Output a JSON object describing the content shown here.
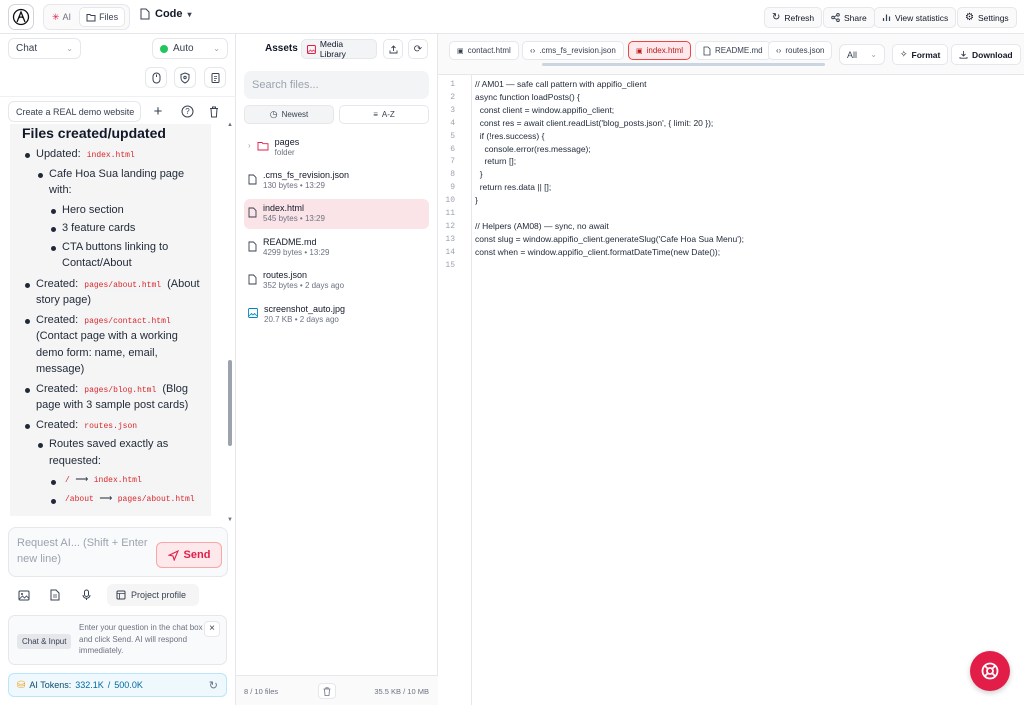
{
  "topbar": {
    "tabs": [
      {
        "label": "AI",
        "icon": "sparkle-icon"
      },
      {
        "label": "Files",
        "icon": "folder-icon"
      }
    ],
    "code_label": "Code",
    "actions": [
      {
        "label": "Refresh",
        "icon": "refresh-icon"
      },
      {
        "label": "Share",
        "icon": "share-icon"
      },
      {
        "label": "View statistics",
        "icon": "bar-chart-icon"
      },
      {
        "label": "Settings",
        "icon": "gear-icon"
      }
    ]
  },
  "chat": {
    "mode_select": "Chat",
    "model_select": "Auto",
    "project_input_value": "Create a REAL demo website",
    "message": {
      "heading": "Files created/updated",
      "updated_label": "Updated:",
      "updated_file": "index.html",
      "updated_desc": "Cafe Hoa Sua landing page with:",
      "sections": [
        "Hero section",
        "3 feature cards",
        "CTA buttons linking to Contact/About"
      ],
      "created_label": "Created:",
      "created": [
        {
          "file": "pages/about.html",
          "desc": "(About story page)"
        },
        {
          "file": "pages/contact.html",
          "desc": "(Contact page with a working demo form: name, email, message)"
        },
        {
          "file": "pages/blog.html",
          "desc": "(Blog page with 3 sample post cards)"
        },
        {
          "file": "routes.json",
          "desc": ""
        }
      ],
      "routes_desc": "Routes saved exactly as requested:",
      "routes": [
        {
          "path": "/",
          "arrow": "⟶",
          "target": "index.html"
        },
        {
          "path": "/about",
          "arrow": "⟶",
          "target": "pages/about.html"
        }
      ]
    },
    "composer_placeholder": "Request AI... (Shift + Enter new line)",
    "send_label": "Send",
    "project_profile_label": "Project profile",
    "hint_badge": "Chat & Input",
    "hint_text": "Enter your question in the chat box and click Send. AI will respond immediately.",
    "tokens_label": "AI Tokens:",
    "tokens_used": "332.1K",
    "tokens_sep": "/",
    "tokens_total": "500.0K"
  },
  "assets": {
    "title": "Assets",
    "media_library_label": "Media Library",
    "search_placeholder": "Search files...",
    "sort_newest": "Newest",
    "sort_az": "A-Z",
    "files": [
      {
        "name": "pages",
        "meta": "folder",
        "icon": "folder-icon"
      },
      {
        "name": ".cms_fs_revision.json",
        "meta": "130 bytes • 13:29",
        "icon": "file-icon"
      },
      {
        "name": "index.html",
        "meta": "545 bytes • 13:29",
        "icon": "file-icon"
      },
      {
        "name": "README.md",
        "meta": "4299 bytes • 13:29",
        "icon": "file-icon"
      },
      {
        "name": "routes.json",
        "meta": "352 bytes • 2 days ago",
        "icon": "file-icon"
      },
      {
        "name": "screenshot_auto.jpg",
        "meta": "20.7 KB • 2 days ago",
        "icon": "image-icon"
      }
    ],
    "footer_count": "8 / 10 files",
    "footer_size": "35.5 KB / 10 MB"
  },
  "editor": {
    "tabs": [
      {
        "label": "contact.html",
        "icon": "html-icon"
      },
      {
        "label": ".cms_fs_revision.json",
        "icon": "code-icon"
      },
      {
        "label": "index.html",
        "icon": "html-icon"
      },
      {
        "label": "README.md",
        "icon": "file-icon"
      },
      {
        "label": "routes.json",
        "icon": "code-icon"
      }
    ],
    "active_tab": "index.html",
    "filter_select": "All",
    "format_label": "Format",
    "download_label": "Download",
    "lines": [
      "// AM01 — safe call pattern with appifio_client",
      "async function loadPosts() {",
      "  const client = window.appifio_client;",
      "  const res = await client.readList('blog_posts.json', { limit: 20 });",
      "  if (!res.success) {",
      "    console.error(res.message);",
      "    return [];",
      "  }",
      "  return res.data || [];",
      "}",
      "",
      "// Helpers (AM08) — sync, no await",
      "const slug = window.appifio_client.generateSlug('Cafe Hoa Sua Menu');",
      "const when = window.appifio_client.formatDateTime(new Date());",
      ""
    ]
  },
  "colors": {
    "accent": "#e11d48",
    "selected_bg": "#fbe4e8",
    "code_red": "#dc2626",
    "status_green": "#22c55e"
  }
}
